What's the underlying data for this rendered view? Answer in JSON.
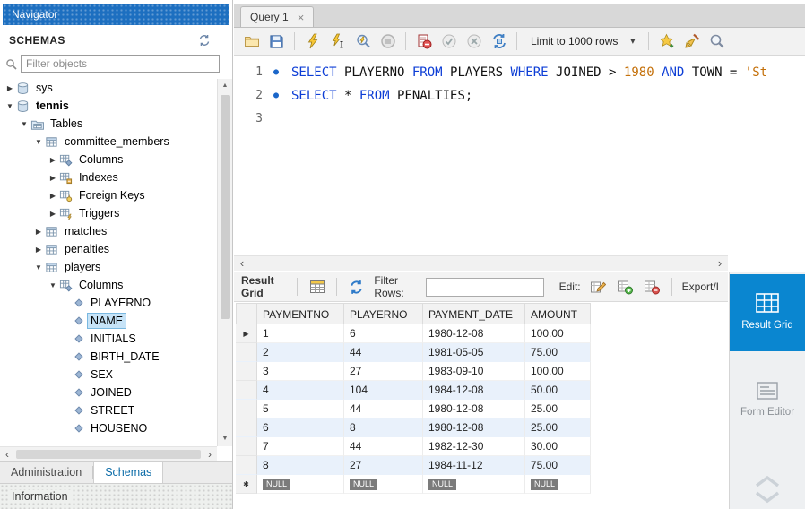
{
  "colors": {
    "titlebar_blue": "#1d6fc0",
    "selection_blue": "#0a86d0",
    "keyword_blue": "#0d3ed6",
    "literal_orange": "#c4700a",
    "row_alt": "#e9f1fb",
    "null_badge": "#7b7b7b",
    "schemas_tab_blue": "#0c6ca8"
  },
  "icons": {
    "expand_collapsed": "▶",
    "expand_expanded": "▼",
    "statement_marker": "●",
    "row_marker": "▶",
    "new_row_marker": "✱",
    "dropdown_caret": "▾",
    "close_tab": "×",
    "scroll_up": "▲",
    "scroll_down": "▼",
    "scroll_left": "‹",
    "scroll_right": "›"
  },
  "navigator": {
    "title": "Navigator",
    "schemas_header": "SCHEMAS",
    "filter_placeholder": "Filter objects",
    "tree": [
      {
        "label": "sys",
        "level": 0,
        "icon": "schema",
        "arrow": "right"
      },
      {
        "label": "tennis",
        "level": 0,
        "icon": "schema",
        "arrow": "down",
        "bold": true
      },
      {
        "label": "Tables",
        "level": 1,
        "icon": "tables",
        "arrow": "down"
      },
      {
        "label": "committee_members",
        "level": 2,
        "icon": "table",
        "arrow": "down"
      },
      {
        "label": "Columns",
        "level": 3,
        "icon": "columns",
        "arrow": "right"
      },
      {
        "label": "Indexes",
        "level": 3,
        "icon": "indexes",
        "arrow": "right"
      },
      {
        "label": "Foreign Keys",
        "level": 3,
        "icon": "fks",
        "arrow": "right"
      },
      {
        "label": "Triggers",
        "level": 3,
        "icon": "triggers",
        "arrow": "right"
      },
      {
        "label": "matches",
        "level": 2,
        "icon": "table",
        "arrow": "right"
      },
      {
        "label": "penalties",
        "level": 2,
        "icon": "table",
        "arrow": "right"
      },
      {
        "label": "players",
        "level": 2,
        "icon": "table",
        "arrow": "down"
      },
      {
        "label": "Columns",
        "level": 3,
        "icon": "columns",
        "arrow": "down"
      },
      {
        "label": "PLAYERNO",
        "level": 4,
        "icon": "column"
      },
      {
        "label": "NAME",
        "level": 4,
        "icon": "column",
        "selected": true
      },
      {
        "label": "INITIALS",
        "level": 4,
        "icon": "column"
      },
      {
        "label": "BIRTH_DATE",
        "level": 4,
        "icon": "column"
      },
      {
        "label": "SEX",
        "level": 4,
        "icon": "column"
      },
      {
        "label": "JOINED",
        "level": 4,
        "icon": "column"
      },
      {
        "label": "STREET",
        "level": 4,
        "icon": "column"
      },
      {
        "label": "HOUSENO",
        "level": 4,
        "icon": "column"
      }
    ],
    "bottom_tabs": [
      {
        "label": "Administration",
        "active": false
      },
      {
        "label": "Schemas",
        "active": true
      }
    ],
    "information_title": "Information"
  },
  "query_tab": {
    "title": "Query 1"
  },
  "toolbar": {
    "limit_label": "Limit to 1000 rows"
  },
  "editor": {
    "lines": [
      {
        "num": "1",
        "marker": true,
        "tokens": [
          [
            "SELECT",
            "kw"
          ],
          [
            " PLAYERNO ",
            "id"
          ],
          [
            "FROM",
            "kw"
          ],
          [
            " PLAYERS ",
            "id"
          ],
          [
            "WHERE",
            "kw"
          ],
          [
            " JOINED > ",
            "id"
          ],
          [
            "1980",
            "lit"
          ],
          [
            " ",
            "id"
          ],
          [
            "AND",
            "kw"
          ],
          [
            " TOWN = ",
            "id"
          ],
          [
            "'St",
            "lit"
          ]
        ]
      },
      {
        "num": "2",
        "marker": true,
        "tokens": [
          [
            "SELECT",
            "kw"
          ],
          [
            " * ",
            "id"
          ],
          [
            "FROM",
            "kw"
          ],
          [
            " PENALTIES;",
            "id"
          ]
        ]
      },
      {
        "num": "3",
        "marker": false,
        "tokens": []
      }
    ]
  },
  "result": {
    "toolbar": {
      "grid_label": "Result Grid",
      "filter_label": "Filter Rows:",
      "filter_value": "",
      "edit_label": "Edit:",
      "export_label": "Export/I"
    },
    "columns": [
      "PAYMENTNO",
      "PLAYERNO",
      "PAYMENT_DATE",
      "AMOUNT"
    ],
    "rows": [
      [
        "1",
        "6",
        "1980-12-08",
        "100.00"
      ],
      [
        "2",
        "44",
        "1981-05-05",
        "75.00"
      ],
      [
        "3",
        "27",
        "1983-09-10",
        "100.00"
      ],
      [
        "4",
        "104",
        "1984-12-08",
        "50.00"
      ],
      [
        "5",
        "44",
        "1980-12-08",
        "25.00"
      ],
      [
        "6",
        "8",
        "1980-12-08",
        "25.00"
      ],
      [
        "7",
        "44",
        "1982-12-30",
        "30.00"
      ],
      [
        "8",
        "27",
        "1984-11-12",
        "75.00"
      ]
    ],
    "new_row": [
      "NULL",
      "NULL",
      "NULL",
      "NULL"
    ]
  },
  "side_panel": {
    "buttons": [
      {
        "label": "Result Grid",
        "active": true
      },
      {
        "label": "Form Editor",
        "active": false
      }
    ]
  }
}
